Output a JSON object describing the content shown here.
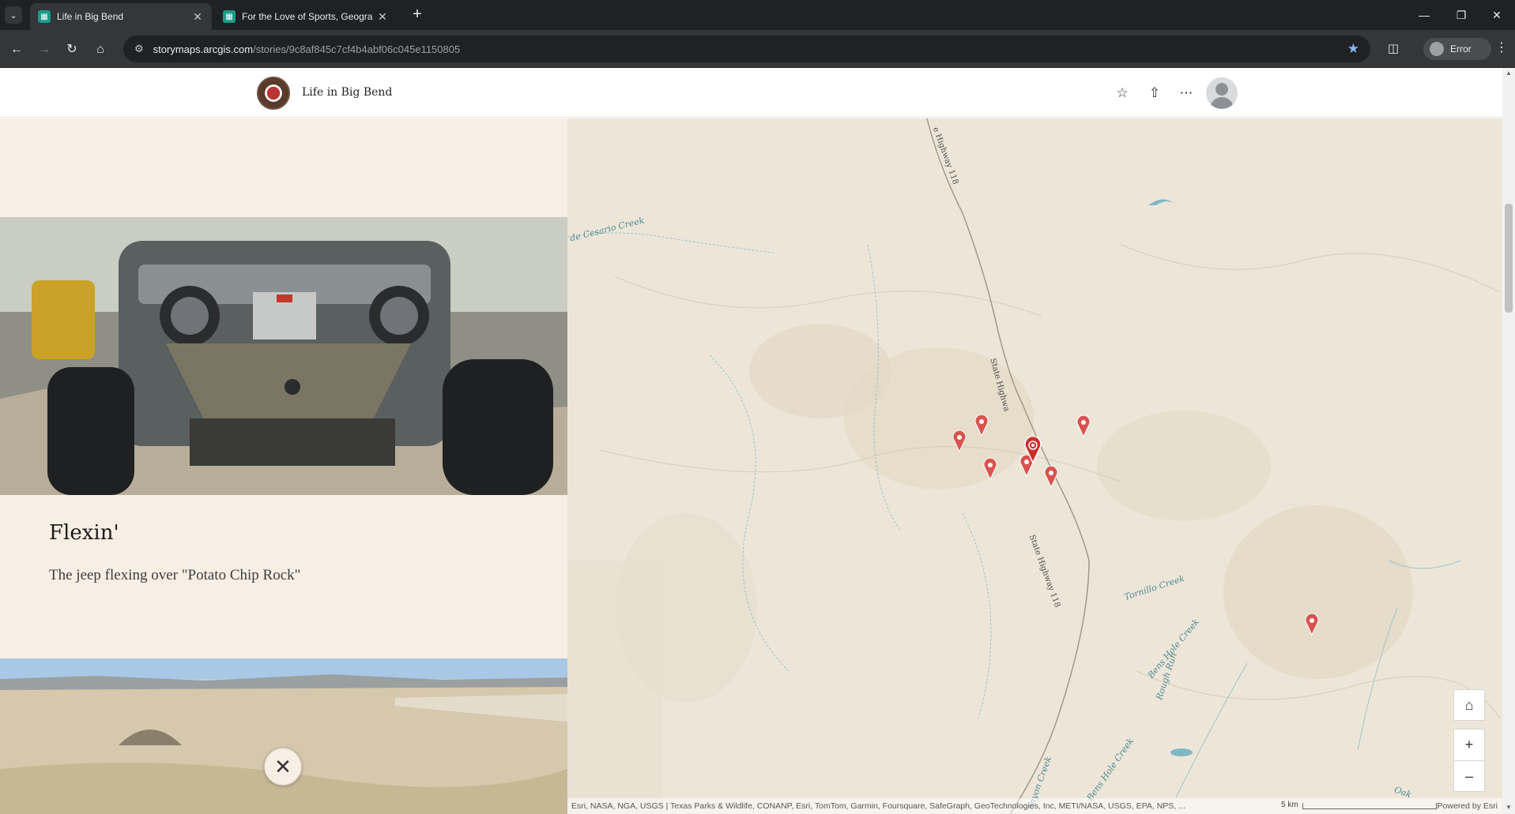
{
  "browser": {
    "tabs": [
      {
        "title": "Life in Big Bend",
        "active": true
      },
      {
        "title": "For the Love of Sports, Geogra",
        "active": false
      }
    ],
    "url_host": "storymaps.arcgis.com",
    "url_path": "/stories/9c8af845c7cf4b4abf06c045e1150805",
    "profile_label": "Error"
  },
  "header": {
    "story_title": "Life in Big Bend"
  },
  "slide": {
    "title": "Flexin'",
    "caption": "The jeep flexing over \"Potato Chip Rock\""
  },
  "map": {
    "labels": {
      "creek_cesario": "de Cesario Creek",
      "highway_north": "e Highway 118",
      "highway_mid": "State Highwa",
      "highway_south": "State Highway 118",
      "bens_hole_1": "Bens Hole Creek",
      "bens_hole_2": "Bens Hole Creek",
      "tornillo": "Tornillo Creek",
      "rough_run": "Rough Run",
      "canyon_creek": "anyon Creek",
      "oak": "Oak"
    },
    "attribution": "Esri, NASA, NGA, USGS | Texas Parks & Wildlife, CONANP, Esri, TomTom, Garmin, Foursquare, SafeGraph, GeoTechnologies, Inc, METI/NASA, USGS, EPA, NPS, ...",
    "scale_label": "5 km",
    "powered_by": "Powered by Esri",
    "marker_color": "#d9534f"
  },
  "colors": {
    "narrative_bg": "#f8efe4",
    "map_bg": "#ede6d8",
    "water": "#7fb8c4"
  }
}
